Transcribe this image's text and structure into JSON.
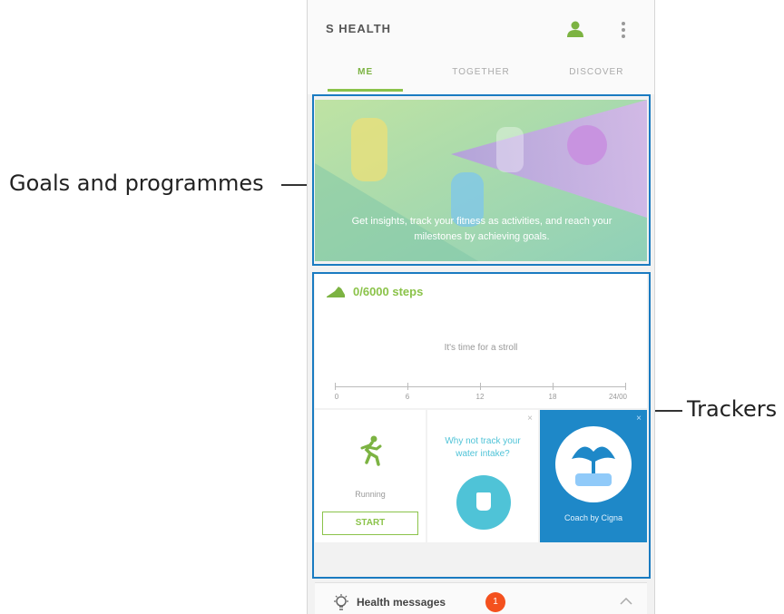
{
  "callouts": {
    "goals_label": "Goals and programmes",
    "trackers_label": "Trackers"
  },
  "app": {
    "title": "S HEALTH",
    "tabs": [
      {
        "label": "ME",
        "active": true
      },
      {
        "label": "TOGETHER",
        "active": false
      },
      {
        "label": "DISCOVER",
        "active": false
      }
    ],
    "icons": {
      "profile": "profile-icon",
      "more": "more-vert-icon"
    }
  },
  "banner": {
    "text": "Get insights, track your fitness as activities, and reach your milestones by achieving goals."
  },
  "steps_tracker": {
    "count_text": "0/6000 steps",
    "message": "It's time for a stroll",
    "scale_labels": [
      "0",
      "6",
      "12",
      "18",
      "24/00"
    ]
  },
  "trackers": {
    "running": {
      "label": "Running",
      "button": "START"
    },
    "water": {
      "label": "Why not track your water intake?",
      "close": "×"
    },
    "coach": {
      "label": "Coach by Cigna",
      "close": "×"
    }
  },
  "health_messages": {
    "title": "Health messages",
    "badge": "1",
    "icon": "lightbulb-icon"
  },
  "colors": {
    "accent": "#8bc34a",
    "highlight_box": "#1a7bc1",
    "water": "#4fc3d7",
    "coach_bg": "#1e88c8",
    "badge": "#f4511e"
  }
}
